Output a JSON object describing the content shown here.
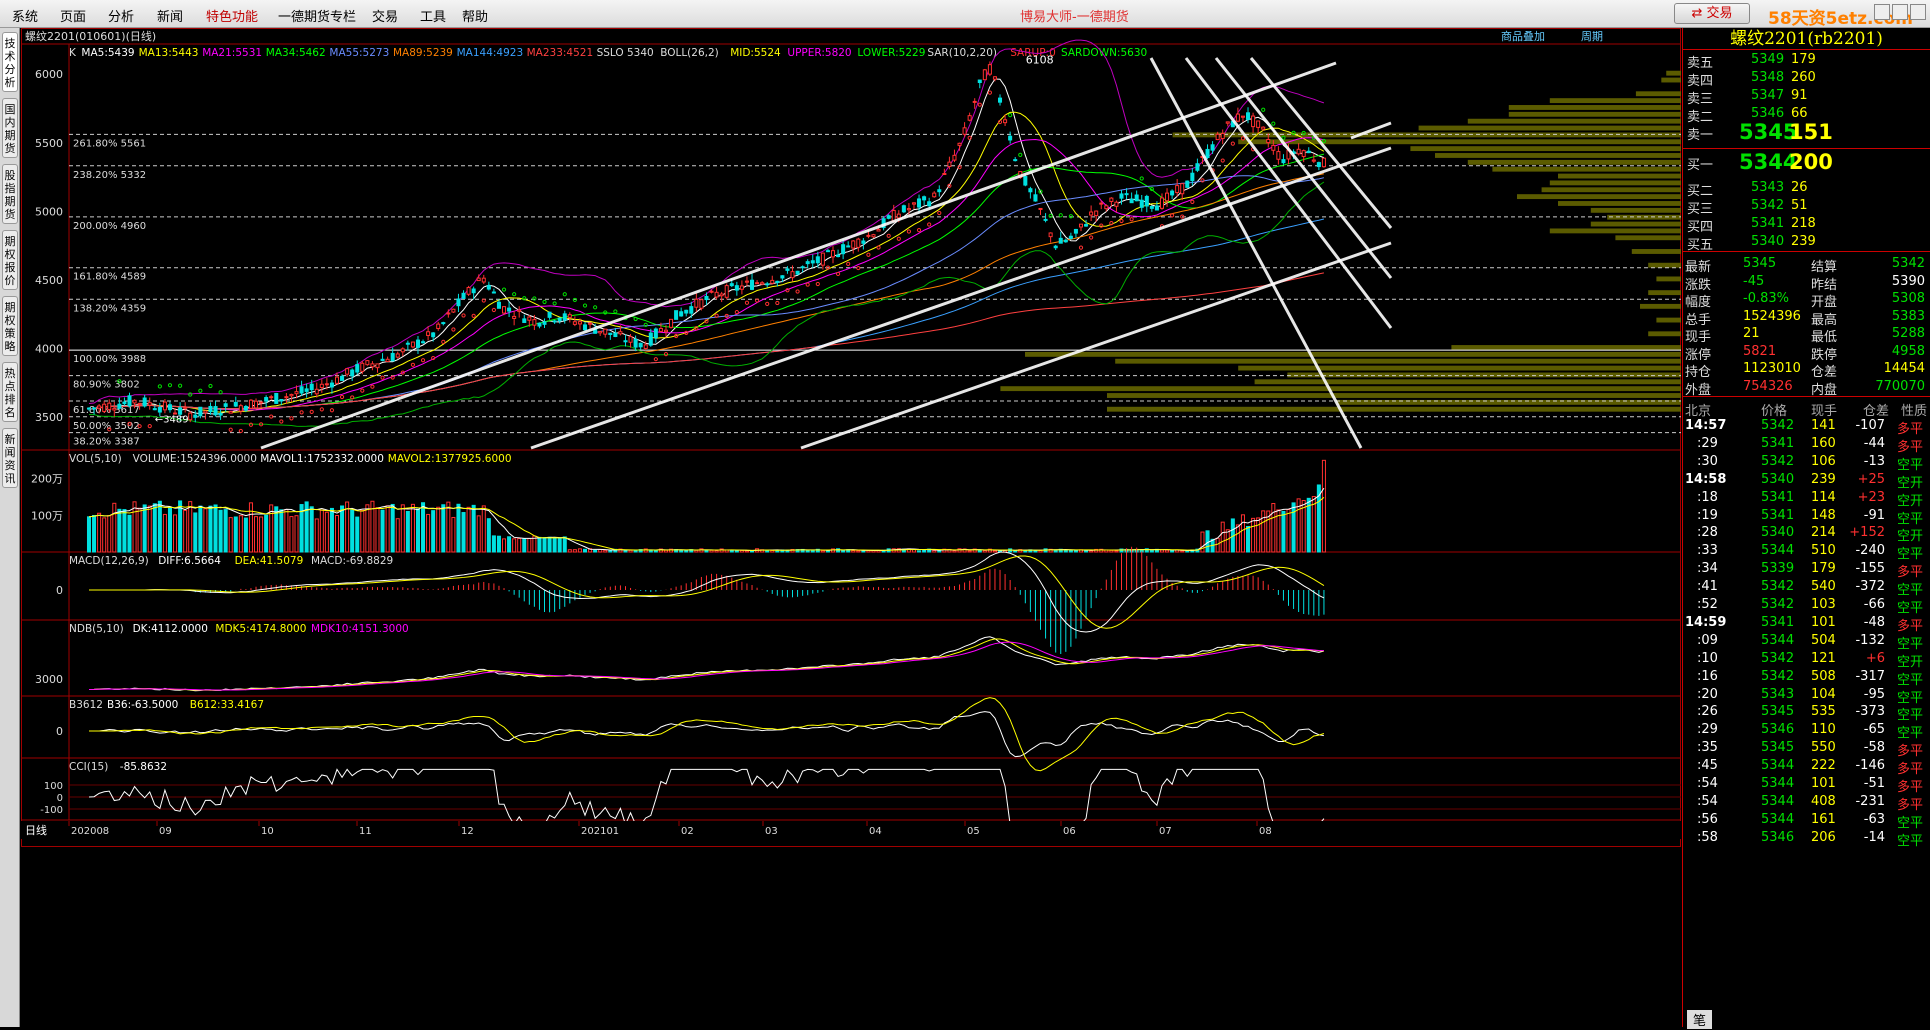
{
  "menu": {
    "items": [
      "系统",
      "页面",
      "分析",
      "新闻",
      "特色功能",
      "一德期货专栏",
      "交易",
      "工具",
      "帮助"
    ],
    "hot_index": 4
  },
  "app_title": "博易大师-一德期货",
  "trade_button": "交易",
  "watermark": "58天资5etz.com",
  "left_tabs": [
    "技术分析",
    "国内期货",
    "股指期货",
    "期权报价",
    "期权策略",
    "热点排名",
    "新闻资讯"
  ],
  "chart": {
    "symbol_label": "螺纹2201(010601)(日线)",
    "toolbar_links": [
      "商品叠加",
      "周期"
    ],
    "main_indicator": [
      {
        "t": "K",
        "c": "#dddddd"
      },
      {
        "t": "MA5:5439",
        "c": "#ffffff"
      },
      {
        "t": "MA13:5443",
        "c": "#ffff00"
      },
      {
        "t": "MA21:5531",
        "c": "#ff00ff"
      },
      {
        "t": "MA34:5462",
        "c": "#00ff00"
      },
      {
        "t": "MA55:5273",
        "c": "#6a8cff"
      },
      {
        "t": "MA89:5239",
        "c": "#ff8000"
      },
      {
        "t": "MA144:4923",
        "c": "#3aa0ff"
      },
      {
        "t": "MA233:4521",
        "c": "#ff4040"
      },
      {
        "t": "SSLO 5340",
        "c": "#dddddd"
      },
      {
        "t": "BOLL(26,2)",
        "c": "#dddddd"
      },
      {
        "t": "MID:5524",
        "c": "#ffff00"
      },
      {
        "t": "UPPER:5820",
        "c": "#ff00ff"
      },
      {
        "t": "LOWER:5229",
        "c": "#00ff00"
      },
      {
        "t": "SAR(10,2,20)",
        "c": "#dddddd"
      },
      {
        "t": "SARUP:0",
        "c": "#ff3030"
      },
      {
        "t": "SARDOWN:5630",
        "c": "#00ff00"
      }
    ],
    "price_ticks": [
      "6000",
      "5500",
      "5000",
      "4500",
      "4000",
      "3500"
    ],
    "fib_levels": [
      {
        "label": "261.80% 5561",
        "price": 5561
      },
      {
        "label": "238.20% 5332",
        "price": 5332
      },
      {
        "label": "200.00% 4960",
        "price": 4960
      },
      {
        "label": "161.80% 4589",
        "price": 4589
      },
      {
        "label": "138.20% 4359",
        "price": 4359
      },
      {
        "label": "100.00% 3988",
        "price": 3988
      },
      {
        "label": "80.90% 3802",
        "price": 3802
      },
      {
        "label": "61.80% 3617",
        "price": 3617
      },
      {
        "label": "50.00% 3502",
        "price": 3502
      },
      {
        "label": "38.20% 3387",
        "price": 3387
      }
    ],
    "high_marker": "6108",
    "low_marker": "3489",
    "vol_indicator": [
      {
        "t": "VOL(5,10)",
        "c": "#dddddd"
      },
      {
        "t": "VOLUME:1524396.0000",
        "c": "#dddddd"
      },
      {
        "t": "MAVOL1:1752332.0000",
        "c": "#ffffff"
      },
      {
        "t": "MAVOL2:1377925.6000",
        "c": "#ffff00"
      }
    ],
    "vol_ticks": [
      "200万",
      "100万"
    ],
    "macd_indicator": [
      {
        "t": "MACD(12,26,9)",
        "c": "#dddddd"
      },
      {
        "t": "DIFF:6.5664",
        "c": "#ffffff"
      },
      {
        "t": "DEA:41.5079",
        "c": "#ffff00"
      },
      {
        "t": "MACD:-69.8829",
        "c": "#dddddd"
      }
    ],
    "macd_ticks": [
      "0"
    ],
    "ndb_indicator": [
      {
        "t": "NDB(5,10)",
        "c": "#dddddd"
      },
      {
        "t": "DK:4112.0000",
        "c": "#ffffff"
      },
      {
        "t": "MDK5:4174.8000",
        "c": "#ffff00"
      },
      {
        "t": "MDK10:4151.3000",
        "c": "#ff00ff"
      }
    ],
    "ndb_ticks": [
      "3000"
    ],
    "b3612_indicator": [
      {
        "t": "B3612",
        "c": "#dddddd"
      },
      {
        "t": "B36:-63.5000",
        "c": "#ffffff"
      },
      {
        "t": "B612:33.4167",
        "c": "#ffff00"
      }
    ],
    "b3612_ticks": [
      "0"
    ],
    "cci_indicator": [
      {
        "t": "CCI(15)",
        "c": "#dddddd"
      },
      {
        "t": "-85.8632",
        "c": "#ffffff"
      }
    ],
    "cci_ticks": [
      "100",
      "0",
      "-100"
    ],
    "period_label": "日线",
    "date_ticks": [
      "202008",
      "09",
      "10",
      "11",
      "12",
      "202101",
      "02",
      "03",
      "04",
      "05",
      "06",
      "07",
      "08"
    ]
  },
  "quote": {
    "title": "螺纹2201(rb2201)",
    "asks": [
      {
        "label": "卖五",
        "price": "5349",
        "vol": "179"
      },
      {
        "label": "卖四",
        "price": "5348",
        "vol": "260"
      },
      {
        "label": "卖三",
        "price": "5347",
        "vol": "91"
      },
      {
        "label": "卖二",
        "price": "5346",
        "vol": "66"
      },
      {
        "label": "卖一",
        "price": "5345",
        "vol": "151"
      }
    ],
    "bids": [
      {
        "label": "买一",
        "price": "5344",
        "vol": "200"
      },
      {
        "label": "买二",
        "price": "5343",
        "vol": "26"
      },
      {
        "label": "买三",
        "price": "5342",
        "vol": "51"
      },
      {
        "label": "买四",
        "price": "5341",
        "vol": "218"
      },
      {
        "label": "买五",
        "price": "5340",
        "vol": "239"
      }
    ],
    "stats": [
      {
        "l1": "最新",
        "v1": "5345",
        "c1": "g",
        "l2": "结算",
        "v2": "5342",
        "c2": "g"
      },
      {
        "l1": "涨跌",
        "v1": "-45",
        "c1": "g",
        "l2": "昨结",
        "v2": "5390",
        "c2": "w"
      },
      {
        "l1": "幅度",
        "v1": "-0.83%",
        "c1": "g",
        "l2": "开盘",
        "v2": "5308",
        "c2": "g"
      },
      {
        "l1": "总手",
        "v1": "1524396",
        "c1": "y",
        "l2": "最高",
        "v2": "5383",
        "c2": "g"
      },
      {
        "l1": "现手",
        "v1": "21",
        "c1": "y",
        "l2": "最低",
        "v2": "5288",
        "c2": "g"
      },
      {
        "l1": "涨停",
        "v1": "5821",
        "c1": "r",
        "l2": "跌停",
        "v2": "4958",
        "c2": "g"
      },
      {
        "l1": "持仓",
        "v1": "1123010",
        "c1": "y",
        "l2": "仓差",
        "v2": "14454",
        "c2": "y"
      },
      {
        "l1": "外盘",
        "v1": "754326",
        "c1": "r",
        "l2": "内盘",
        "v2": "770070",
        "c2": "g"
      }
    ],
    "tick_header": [
      "北京",
      "价格",
      "现手",
      "仓差",
      "性质"
    ],
    "ticks": [
      {
        "t": "14:57",
        "p": "5342",
        "v": "141",
        "d": "-107",
        "n": "多平"
      },
      {
        "t": ":29",
        "p": "5341",
        "v": "160",
        "d": "-44",
        "n": "多平"
      },
      {
        "t": ":30",
        "p": "5342",
        "v": "106",
        "d": "-13",
        "n": "空平"
      },
      {
        "t": "14:58",
        "p": "5340",
        "v": "239",
        "d": "+25",
        "n": "空开"
      },
      {
        "t": ":18",
        "p": "5341",
        "v": "114",
        "d": "+23",
        "n": "空开"
      },
      {
        "t": ":19",
        "p": "5341",
        "v": "148",
        "d": "-91",
        "n": "空平"
      },
      {
        "t": ":28",
        "p": "5340",
        "v": "214",
        "d": "+152",
        "n": "空开"
      },
      {
        "t": ":33",
        "p": "5344",
        "v": "510",
        "d": "-240",
        "n": "空平"
      },
      {
        "t": ":34",
        "p": "5339",
        "v": "179",
        "d": "-155",
        "n": "多平"
      },
      {
        "t": ":41",
        "p": "5342",
        "v": "540",
        "d": "-372",
        "n": "空平"
      },
      {
        "t": ":52",
        "p": "5342",
        "v": "103",
        "d": "-66",
        "n": "空平"
      },
      {
        "t": "14:59",
        "p": "5341",
        "v": "101",
        "d": "-48",
        "n": "多平"
      },
      {
        "t": ":09",
        "p": "5344",
        "v": "504",
        "d": "-132",
        "n": "空平"
      },
      {
        "t": ":10",
        "p": "5342",
        "v": "121",
        "d": "+6",
        "n": "空开"
      },
      {
        "t": ":16",
        "p": "5342",
        "v": "508",
        "d": "-317",
        "n": "空平"
      },
      {
        "t": ":20",
        "p": "5343",
        "v": "104",
        "d": "-95",
        "n": "空平"
      },
      {
        "t": ":26",
        "p": "5345",
        "v": "535",
        "d": "-373",
        "n": "空平"
      },
      {
        "t": ":29",
        "p": "5346",
        "v": "110",
        "d": "-65",
        "n": "空平"
      },
      {
        "t": ":35",
        "p": "5345",
        "v": "550",
        "d": "-58",
        "n": "多平"
      },
      {
        "t": ":45",
        "p": "5344",
        "v": "222",
        "d": "-146",
        "n": "多平"
      },
      {
        "t": ":54",
        "p": "5344",
        "v": "101",
        "d": "-51",
        "n": "多平"
      },
      {
        "t": ":54",
        "p": "5344",
        "v": "408",
        "d": "-231",
        "n": "多平"
      },
      {
        "t": ":56",
        "p": "5344",
        "v": "161",
        "d": "-63",
        "n": "空平"
      },
      {
        "t": ":58",
        "p": "5346",
        "v": "206",
        "d": "-14",
        "n": "空平"
      }
    ],
    "footer_tab": "笔"
  }
}
